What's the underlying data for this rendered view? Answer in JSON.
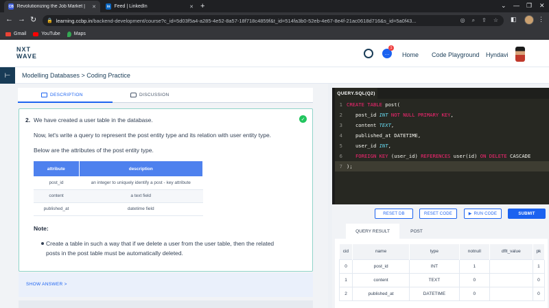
{
  "browser": {
    "tabs": [
      {
        "title": "Revolutionizing the Job Market |",
        "active": true
      },
      {
        "title": "Feed | LinkedIn",
        "active": false
      }
    ],
    "url_host": "learning.ccbp.in",
    "url_path": "/backend-development/course?c_id=5d03f5a4-a285-4e52-8a57-18f718c4859f&t_id=514fa3b0-52eb-4e67-8e4f-21ac0618d716&s_id=5a0f43...",
    "bookmarks": [
      "Gmail",
      "YouTube",
      "Maps"
    ]
  },
  "header": {
    "logo_line1": "NXT",
    "logo_line2": "WAVE",
    "notification_count": "1",
    "home": "Home",
    "code_playground": "Code Playground",
    "user_name": "Hyndavi"
  },
  "breadcrumb": "Modelling Databases > Coding Practice",
  "left_tabs": {
    "description": "DESCRIPTION",
    "discussion": "DISCUSSION"
  },
  "question": {
    "number": "2.",
    "line1": "We have created a user table in the database.",
    "line2": "Now, let's write a query to represent the post entity type and its relation with user entity type.",
    "line3": "Below are the attributes of the post entity type.",
    "table_headers": [
      "attribute",
      "description"
    ],
    "table_rows": [
      [
        "post_id",
        "an integer to uniquely identify a post - key attribute"
      ],
      [
        "content",
        "a text field"
      ],
      [
        "published_at",
        "datetime field"
      ]
    ],
    "note_label": "Note:",
    "note_line1": "Create a table in such a way that if we delete a user from the user table, then the related",
    "note_line2": "posts in the post table must be automatically deleted."
  },
  "show_answer": "SHOW ANSWER >",
  "editor": {
    "file_tab": "QUERY.SQL(Q2)",
    "line_numbers": [
      "1",
      "2",
      "3",
      "4",
      "5",
      "6",
      "7"
    ],
    "code": {
      "l1_kw": "CREATE TABLE",
      "l1_rest": " post(",
      "l2_a": "post_id ",
      "l2_ty": "INT",
      "l2_kw": " NOT NULL PRIMARY KEY",
      "l2_end": ",",
      "l3_a": "content ",
      "l3_ty": "TEXT",
      "l3_end": ",",
      "l4": "published_at DATETIME,",
      "l5_a": "user_id ",
      "l5_ty": "INT",
      "l5_end": ",",
      "l6_kw1": "FOREIGN KEY",
      "l6_a": " (user_id) ",
      "l6_kw2": "REFERENCES",
      "l6_b": " user(id) ",
      "l6_kw3": "ON DELETE",
      "l6_c": " CASCADE",
      "l7": ");"
    }
  },
  "buttons": {
    "reset_db": "RESET DB",
    "reset_code": "RESET CODE",
    "run_code": "RUN CODE",
    "submit": "SUBMIT"
  },
  "result": {
    "tabs": [
      "QUERY RESULT",
      "POST"
    ],
    "headers": [
      "cid",
      "name",
      "type",
      "notnull",
      "dflt_value",
      "pk"
    ],
    "rows": [
      [
        "0",
        "post_id",
        "INT",
        "1",
        "",
        "1"
      ],
      [
        "1",
        "content",
        "TEXT",
        "0",
        "",
        "0"
      ],
      [
        "2",
        "published_at",
        "DATETIME",
        "0",
        "",
        "0"
      ]
    ]
  }
}
